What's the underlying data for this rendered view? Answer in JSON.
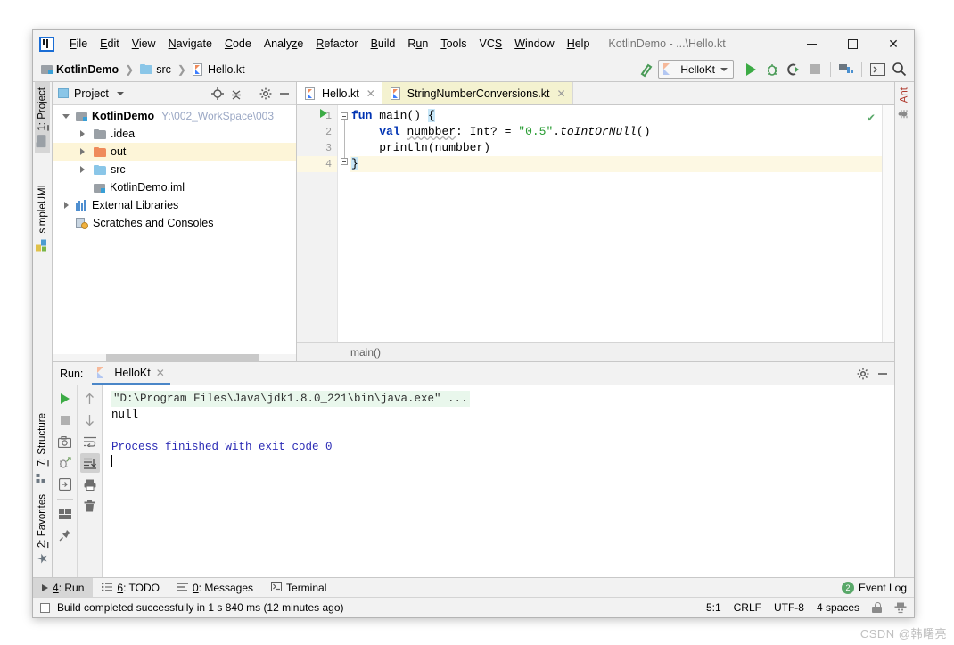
{
  "window": {
    "title": "KotlinDemo - ...\\Hello.kt",
    "minimize": "minimize-button",
    "maximize": "maximize-button",
    "close": "close-button"
  },
  "menu": [
    {
      "label": "File",
      "mnemonic": "F"
    },
    {
      "label": "Edit",
      "mnemonic": "E"
    },
    {
      "label": "View",
      "mnemonic": "V"
    },
    {
      "label": "Navigate",
      "mnemonic": "N"
    },
    {
      "label": "Code",
      "mnemonic": "C"
    },
    {
      "label": "Analyze",
      "mnemonic": "z"
    },
    {
      "label": "Refactor",
      "mnemonic": "R"
    },
    {
      "label": "Build",
      "mnemonic": "B"
    },
    {
      "label": "Run",
      "mnemonic": "u"
    },
    {
      "label": "Tools",
      "mnemonic": "T"
    },
    {
      "label": "VCS",
      "mnemonic": "S"
    },
    {
      "label": "Window",
      "mnemonic": "W"
    },
    {
      "label": "Help",
      "mnemonic": "H"
    }
  ],
  "navbar": {
    "breadcrumbs": [
      {
        "label": "KotlinDemo",
        "icon": "module-icon"
      },
      {
        "label": "src",
        "icon": "folder-icon"
      },
      {
        "label": "Hello.kt",
        "icon": "kotlin-file-icon"
      }
    ],
    "run_config": "HelloKt",
    "icons": [
      "hammer-build-icon",
      "run-icon",
      "debug-icon",
      "run-with-coverage-icon",
      "stop-icon",
      "project-structure-icon",
      "terminal-icon",
      "search-everywhere-icon"
    ]
  },
  "left_strip": {
    "tabs": [
      {
        "label": "1: Project",
        "mnemonic": "1",
        "active": true
      },
      {
        "label": "simpleUML",
        "active": false
      }
    ],
    "bottom_tabs": [
      {
        "label": "7: Structure",
        "mnemonic": "7"
      },
      {
        "label": "2: Favorites",
        "mnemonic": "2"
      }
    ]
  },
  "right_strip": {
    "tabs": [
      {
        "label": "Ant"
      }
    ]
  },
  "project_pane": {
    "title": "Project",
    "tools": [
      "locate-icon",
      "collapse-all-icon",
      "settings-gear-icon",
      "hide-icon"
    ],
    "tree": [
      {
        "label": "KotlinDemo",
        "path": "Y:\\002_WorkSpace\\003",
        "icon": "module-icon",
        "depth": 0,
        "twisty": "down",
        "bold": true,
        "selected": false
      },
      {
        "label": ".idea",
        "icon": "folder-gray-icon",
        "depth": 1,
        "twisty": "right",
        "selected": false
      },
      {
        "label": "out",
        "icon": "folder-orange-icon",
        "depth": 1,
        "twisty": "right",
        "selected": true
      },
      {
        "label": "src",
        "icon": "folder-blue-icon",
        "depth": 1,
        "twisty": "right",
        "selected": false
      },
      {
        "label": "KotlinDemo.iml",
        "icon": "module-file-icon",
        "depth": 1,
        "twisty": "none",
        "selected": false
      },
      {
        "label": "External Libraries",
        "icon": "library-icon",
        "depth": 0,
        "twisty": "right",
        "selected": false
      },
      {
        "label": "Scratches and Consoles",
        "icon": "scratches-icon",
        "depth": 0,
        "twisty": "none",
        "selected": false
      }
    ]
  },
  "editor": {
    "tabs": [
      {
        "label": "Hello.kt",
        "active": true,
        "icon": "kotlin-file-icon"
      },
      {
        "label": "StringNumberConversions.kt",
        "active": false,
        "highlight": true,
        "icon": "kotlin-file-icon"
      }
    ],
    "gutter_lines": [
      "1",
      "2",
      "3",
      "4"
    ],
    "code": [
      {
        "n": 1,
        "tokens": [
          {
            "t": "fun ",
            "c": "kw"
          },
          {
            "t": "main",
            "c": "fn"
          },
          {
            "t": "() ",
            "c": "plain"
          },
          {
            "t": "{",
            "c": "brace"
          }
        ]
      },
      {
        "n": 2,
        "tokens": [
          {
            "t": "    ",
            "c": "plain"
          },
          {
            "t": "val ",
            "c": "kw"
          },
          {
            "t": "numbber",
            "c": "squiggle"
          },
          {
            "t": ": Int? = ",
            "c": "plain"
          },
          {
            "t": "\"0.5\"",
            "c": "str"
          },
          {
            "t": ".",
            "c": "plain"
          },
          {
            "t": "toIntOrNull",
            "c": "ext"
          },
          {
            "t": "()",
            "c": "plain"
          }
        ]
      },
      {
        "n": 3,
        "tokens": [
          {
            "t": "    println(numbber)",
            "c": "plain"
          }
        ]
      },
      {
        "n": 4,
        "tokens": [
          {
            "t": "}",
            "c": "brace"
          }
        ]
      }
    ],
    "breadcrumb": "main()",
    "inspection_status": "✔"
  },
  "run_panel": {
    "label": "Run:",
    "tab": "HelloKt",
    "tools": [
      "settings-gear-icon",
      "hide-icon"
    ],
    "side_buttons_col1": [
      "rerun-icon",
      "stop-icon",
      "camera-icon",
      "debug-dump-icon",
      "export-icon",
      "layout-icon",
      "pin-icon"
    ],
    "side_buttons_col2": [
      "up-icon",
      "down-icon",
      "soft-wrap-icon",
      "scroll-to-end-icon",
      "print-icon",
      "trash-icon"
    ],
    "console": [
      {
        "text": "\"D:\\Program Files\\Java\\jdk1.8.0_221\\bin\\java.exe\" ...",
        "style": "command"
      },
      {
        "text": "null",
        "style": "output"
      },
      {
        "text": "",
        "style": "output"
      },
      {
        "text": "Process finished with exit code 0",
        "style": "process"
      }
    ]
  },
  "bottom_tabs": [
    {
      "label": "4: Run",
      "mnemonic": "4",
      "icon": "run-icon",
      "active": true
    },
    {
      "label": "6: TODO",
      "mnemonic": "6",
      "icon": "todo-icon",
      "active": false
    },
    {
      "label": "0: Messages",
      "mnemonic": "0",
      "icon": "messages-icon",
      "active": false
    },
    {
      "label": "Terminal",
      "icon": "terminal-icon",
      "active": false
    }
  ],
  "event_log": {
    "label": "Event Log",
    "count": "2"
  },
  "status_bar": {
    "message": "Build completed successfully in 1 s 840 ms (12 minutes ago)",
    "caret_position": "5:1",
    "line_separator": "CRLF",
    "encoding": "UTF-8",
    "indent": "4 spaces",
    "icons": [
      "lock-icon",
      "inspections-hector-icon"
    ]
  },
  "watermark": "CSDN @韩曙亮",
  "colors": {
    "accent": "#4a86c8",
    "green": "#3cab45",
    "selection": "#fdf5d8",
    "caret_line": "#fdf8e3",
    "keyword": "#0033b3",
    "string": "#2a9d34",
    "console_process": "#2b2bb5",
    "command_bg": "#e9f7ec"
  }
}
